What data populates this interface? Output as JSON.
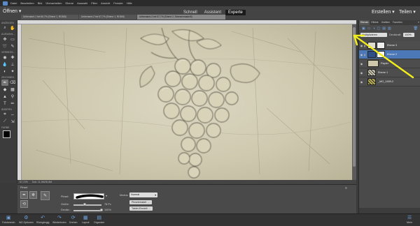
{
  "menubar": {
    "items": [
      "Datei",
      "Bearbeiten",
      "Bild",
      "Überarbeiten",
      "Ebene",
      "Auswahl",
      "Filter",
      "Ansicht",
      "Fenster",
      "Hilfe"
    ]
  },
  "modebar": {
    "open_label": "Öffnen",
    "modes": [
      "Schnell",
      "Assistent",
      "Experte"
    ],
    "active_mode": "Experte",
    "create_label": "Erstellen",
    "share_label": "Teilen"
  },
  "tabs": [
    "Unbenannt-1 bei 66,7% (Ebene 1, RGB/8)",
    "Unbenannt-2 bei 57,7% (Ebene 1, RGB/8)",
    "Unbenannt-3 bei 57,7% (Ebene 2, Ebenenmaske/8)"
  ],
  "active_tab": 2,
  "toolbox": {
    "sections": [
      "ANZEIGEN",
      "AUSWÄHL...",
      "VERBESS...",
      "ZEICHNEN",
      "ÄNDERN",
      "FARBE"
    ]
  },
  "statusbar": {
    "zoom": "57,72%",
    "doc_info": "Dok: 11,9M/30,8M"
  },
  "tool_options": {
    "title": "Pinsel",
    "brush_label": "Pinsel:",
    "size_label": "Größe:",
    "size_value": "78 Px",
    "size_level": 0.4,
    "opacity_label": "Deckkr.:",
    "opacity_value": "100%",
    "opacity_level": 1.0,
    "mode_label": "Modus:",
    "mode_value": "Normal",
    "brush_settings": "Pinseleinstell. ...",
    "tablet_settings": "Tablet-Einstell. ..."
  },
  "taskbar": {
    "items": [
      "Fotobereich",
      "WZ-Optionen",
      "Rückgängig",
      "Wiederholen",
      "Drehen",
      "Layout",
      "Organizer"
    ],
    "right_item": "Mehr"
  },
  "panel": {
    "tabs": [
      "Ebenen",
      "Effekte",
      "Grafiken",
      "Favoriten"
    ],
    "blend_mode": "Multiplizieren",
    "opacity_label": "Deckkraft:",
    "opacity_value": "100%",
    "layers": [
      {
        "name": "Ebene 3",
        "selected": false,
        "thumb": "#dedbd0"
      },
      {
        "name": "Ebene 2",
        "selected": true,
        "thumb": "#eeeeee"
      },
      {
        "name": "Papier",
        "selected": false,
        "thumb": "#cfc7a9"
      },
      {
        "name": "Ebene 1",
        "selected": false,
        "thumb": "#c8c3aa"
      },
      {
        "name": "_MG_2459-2",
        "selected": false,
        "thumb": "#b8ad55"
      }
    ]
  },
  "colors": {
    "accent": "#4c78b8",
    "arrow": "#f2ee1c",
    "canvas": "#d6d0b8"
  }
}
